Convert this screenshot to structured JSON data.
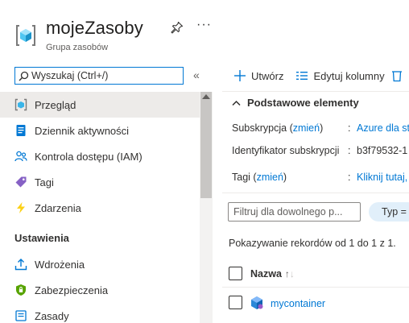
{
  "header": {
    "title": "mojeZasoby",
    "subtitle": "Grupa zasobów",
    "more": "···",
    "icons": {
      "resource_group": "resource-group-icon",
      "pin": "pin-icon"
    }
  },
  "search": {
    "placeholder": "Wyszukaj (Ctrl+/)",
    "collapse": "«"
  },
  "sidebar": {
    "items": [
      {
        "label": "Przegląd",
        "icon": "overview-icon",
        "selected": true
      },
      {
        "label": "Dziennik aktywności",
        "icon": "activity-log-icon"
      },
      {
        "label": "Kontrola dostępu (IAM)",
        "icon": "iam-icon"
      },
      {
        "label": "Tagi",
        "icon": "tag-icon"
      },
      {
        "label": "Zdarzenia",
        "icon": "events-icon"
      }
    ],
    "section": "Ustawienia",
    "settings_items": [
      {
        "label": "Wdrożenia",
        "icon": "deployments-icon"
      },
      {
        "label": "Zabezpieczenia",
        "icon": "security-icon"
      },
      {
        "label": "Zasady",
        "icon": "policies-icon"
      }
    ]
  },
  "toolbar": {
    "create": "Utwórz",
    "edit_columns": "Edytuj kolumny"
  },
  "essentials": {
    "heading": "Podstawowe elementy",
    "rows": [
      {
        "label": "Subskrypcja",
        "change": "zmień",
        "value": "Azure dla st"
      },
      {
        "label": "Identyfikator subskrypcji",
        "value": "b3f79532-1"
      },
      {
        "label": "Tagi",
        "change": "zmień",
        "value": "Kliknij tutaj,"
      }
    ]
  },
  "filter": {
    "placeholder": "Filtruj dla dowolnego p...",
    "type_pill": "Typ ="
  },
  "records_text": "Pokazywanie rekordów od 1 do 1 z 1.",
  "table": {
    "column_name": "Nazwa",
    "sort_glyph": "↑",
    "sort_glyph_dim": "↓",
    "rows": [
      {
        "name": "mycontainer",
        "icon": "container-instance-icon"
      }
    ]
  }
}
